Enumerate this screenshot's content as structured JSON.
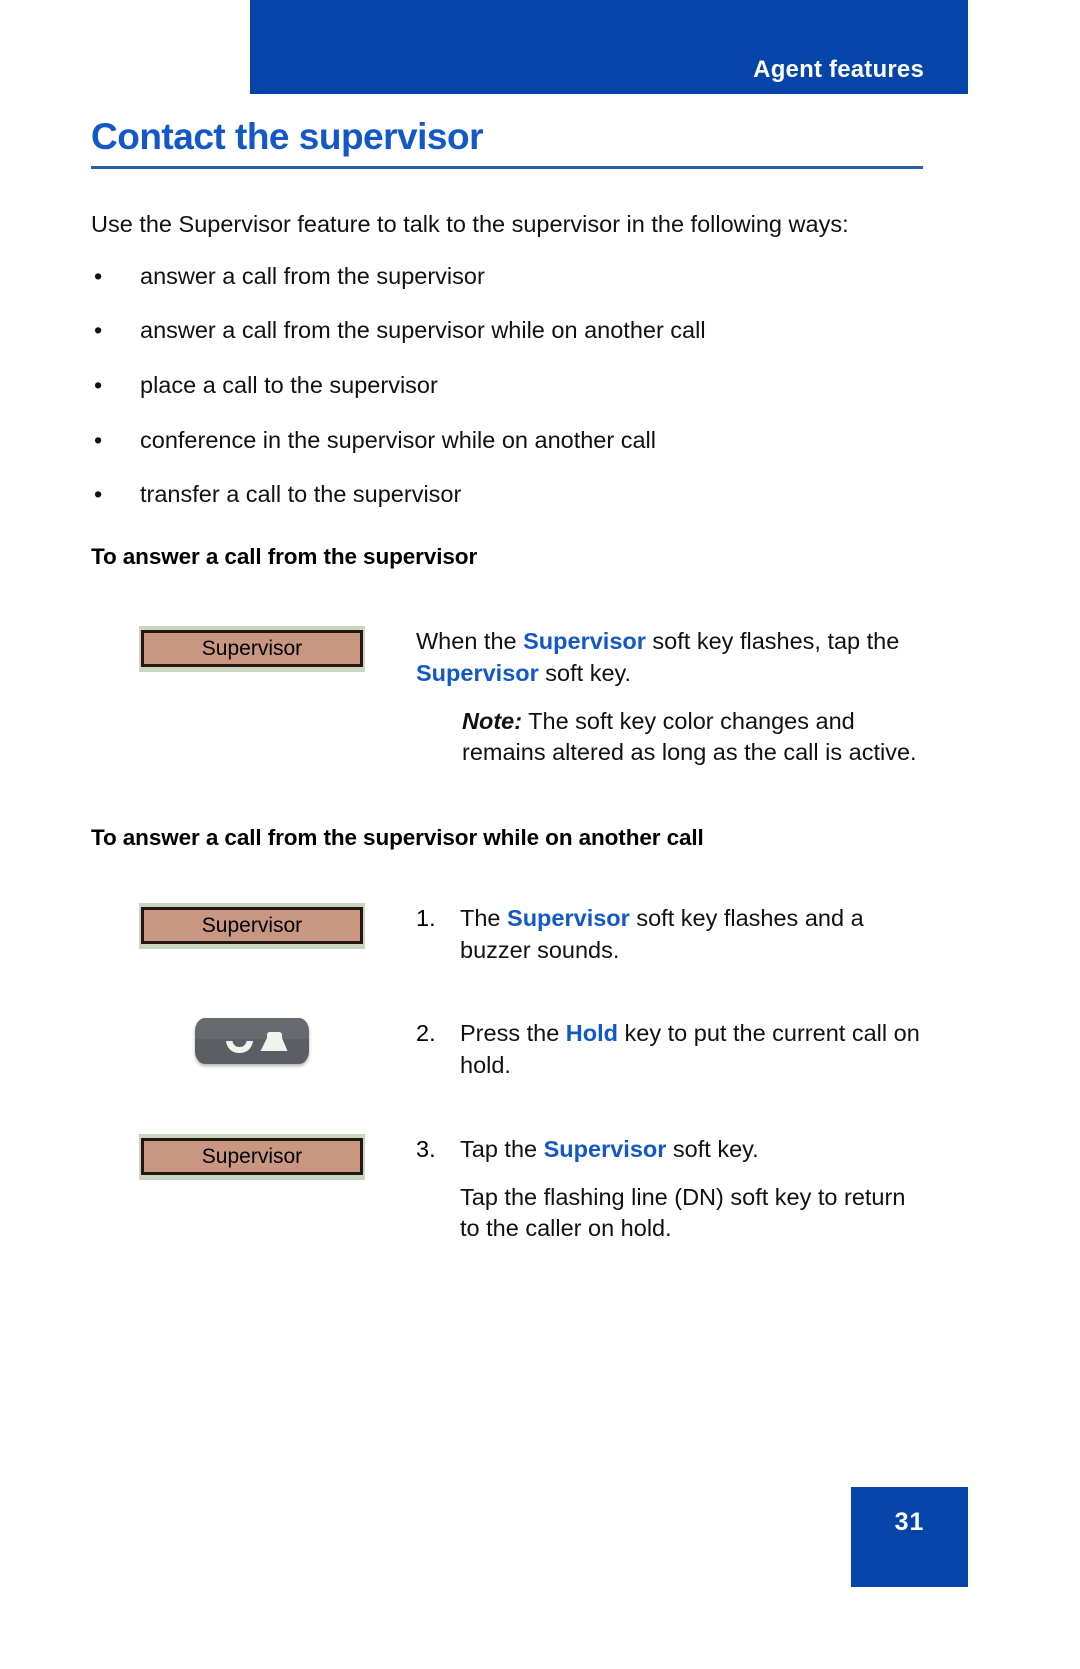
{
  "header": {
    "title": "Agent features",
    "banner_color": "#0544A8"
  },
  "page_title": "Contact the supervisor",
  "intro": "Use the Supervisor feature to talk to the supervisor in the following ways:",
  "bullet_marker": "•",
  "bullets": [
    "answer a call from the supervisor",
    "answer a call from the supervisor while on another call",
    "place a call to the supervisor",
    "conference in the supervisor while on another call",
    "transfer a call to the supervisor"
  ],
  "sections": [
    {
      "heading": "To answer a call from the supervisor",
      "softkey_label": "Supervisor",
      "text_pre": "When the ",
      "kw1": "Supervisor",
      "text_mid": " soft key flashes, tap the ",
      "kw2": "Supervisor",
      "text_post": " soft key.",
      "note_label": "Note:",
      "note_text": " The soft key color changes and remains altered as long as the call is active."
    },
    {
      "heading": "To answer a call from the supervisor while on another call",
      "steps": [
        {
          "num": "1.",
          "art": "softkey",
          "softkey_label": "Supervisor",
          "text_pre": "The ",
          "kw": "Supervisor",
          "text_post": " soft key flashes and a buzzer sounds."
        },
        {
          "num": "2.",
          "art": "holdkey",
          "text_pre": "Press the ",
          "kw": "Hold",
          "text_post": " key to put the current call on hold."
        },
        {
          "num": "3.",
          "art": "softkey",
          "softkey_label": "Supervisor",
          "text_pre": "Tap the ",
          "kw": "Supervisor",
          "text_post": " soft key.",
          "extra_text": "Tap the flashing line (DN) soft key to return to the caller on hold."
        }
      ]
    }
  ],
  "footer": {
    "page_number": "31",
    "box_color": "#0544A8"
  },
  "colors": {
    "accent_blue": "#0544A8",
    "keyword_blue": "#1358C8",
    "softkey_body": "#C99682",
    "softkey_frame": "#C9D7C0",
    "holdkey_body": "#5B5F63"
  }
}
